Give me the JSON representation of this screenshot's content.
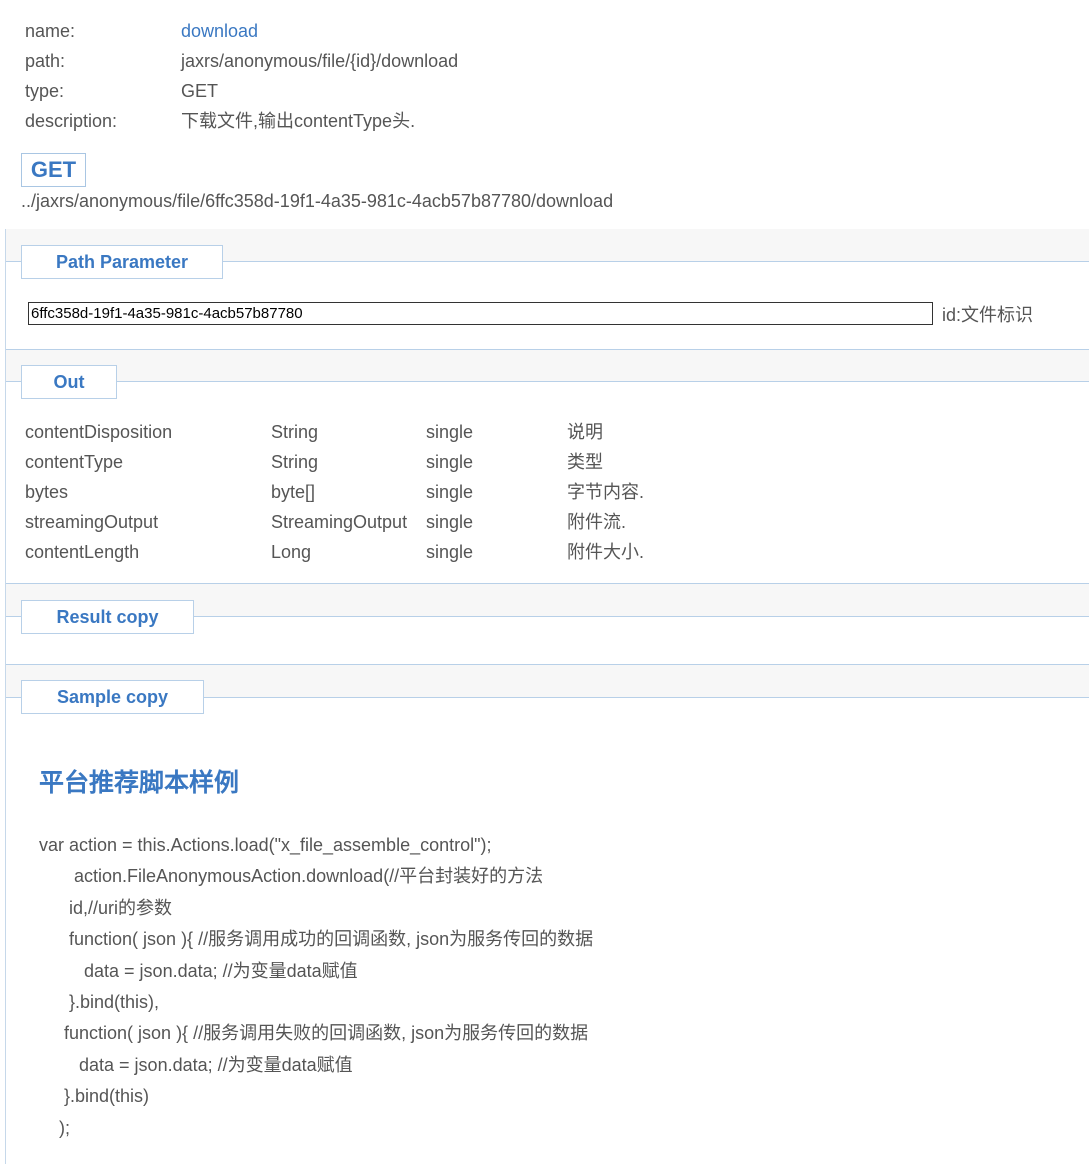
{
  "info": {
    "name_key": "name:",
    "name_val": "download",
    "path_key": "path:",
    "path_val": "jaxrs/anonymous/file/{id}/download",
    "type_key": "type:",
    "type_val": "GET",
    "desc_key": "description:",
    "desc_val": "下载文件,输出contentType头."
  },
  "request": {
    "method": "GET",
    "url": "../jaxrs/anonymous/file/6ffc358d-19f1-4a35-981c-4acb57b87780/download"
  },
  "path_parameter": {
    "tab_label": "Path Parameter",
    "input_value": "6ffc358d-19f1-4a35-981c-4acb57b87780",
    "description": "id:文件标识"
  },
  "out": {
    "tab_label": "Out",
    "rows": [
      {
        "name": "contentDisposition",
        "type": "String",
        "mode": "single",
        "desc": "说明"
      },
      {
        "name": "contentType",
        "type": "String",
        "mode": "single",
        "desc": "类型"
      },
      {
        "name": "bytes",
        "type": "byte[]",
        "mode": "single",
        "desc": "字节内容."
      },
      {
        "name": "streamingOutput",
        "type": "StreamingOutput",
        "mode": "single",
        "desc": "附件流."
      },
      {
        "name": "contentLength",
        "type": "Long",
        "mode": "single",
        "desc": "附件大小."
      }
    ]
  },
  "result": {
    "tab_label": "Result copy"
  },
  "sample": {
    "tab_label": "Sample copy",
    "title": "平台推荐脚本样例",
    "code_lines": [
      "var action = this.Actions.load(\"x_file_assemble_control\");",
      "       action.FileAnonymousAction.download(//平台封装好的方法",
      "      id,//uri的参数",
      "      function( json ){ //服务调用成功的回调函数, json为服务传回的数据",
      "         data = json.data; //为变量data赋值",
      "      }.bind(this),",
      "     function( json ){ //服务调用失败的回调函数, json为服务传回的数据",
      "        data = json.data; //为变量data赋值",
      "     }.bind(this)",
      "    );"
    ]
  },
  "colors": {
    "accent": "#3a78c2",
    "text": "#555555",
    "border": "#b8d0e8",
    "background_strip": "#f7f7f7"
  }
}
